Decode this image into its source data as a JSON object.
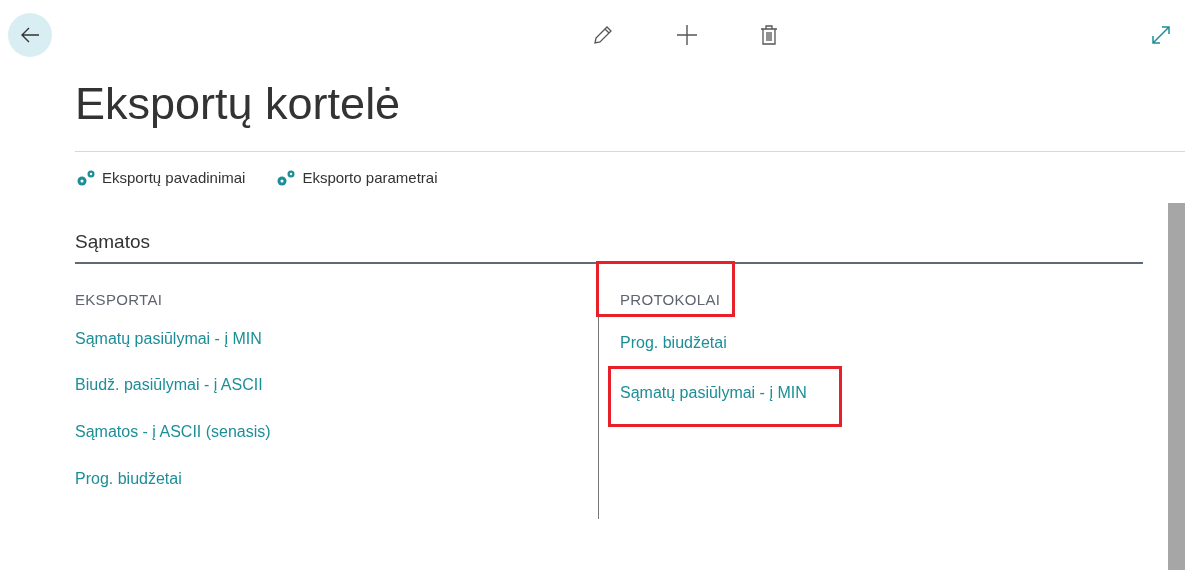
{
  "page": {
    "title": "Eksportų kortelė"
  },
  "actions": [
    {
      "label": "Eksportų pavadinimai"
    },
    {
      "label": "Eksporto parametrai"
    }
  ],
  "section": {
    "title": "Sąmatos",
    "groups": [
      {
        "heading": "EKSPORTAI",
        "highlighted": false,
        "links": [
          {
            "label": "Sąmatų pasiūlymai - į MIN",
            "highlighted": false
          },
          {
            "label": "Biudž. pasiūlymai - į ASCII",
            "highlighted": false
          },
          {
            "label": "Sąmatos - į ASCII (senasis)",
            "highlighted": false
          },
          {
            "label": "Prog. biudžetai",
            "highlighted": false
          }
        ]
      },
      {
        "heading": "PROTOKOLAI",
        "highlighted": true,
        "links": [
          {
            "label": "Prog. biudžetai",
            "highlighted": false
          },
          {
            "label": "Sąmatų pasiūlymai - į MIN",
            "highlighted": true
          }
        ]
      }
    ]
  }
}
